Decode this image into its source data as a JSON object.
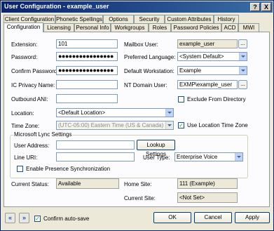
{
  "window": {
    "title": "User Configuration - example_user",
    "help": "?",
    "close": "X"
  },
  "tabs_top": [
    "Client Configuration",
    "Phonetic Spellings",
    "Options",
    "Security",
    "Custom Attributes",
    "History"
  ],
  "tabs_bottom": [
    "Configuration",
    "Licensing",
    "Personal Info",
    "Workgroups",
    "Roles",
    "Password Policies",
    "ACD",
    "MWI"
  ],
  "form": {
    "extension_label": "Extension:",
    "extension_value": "101",
    "password_label": "Password:",
    "password_value": "●●●●●●●●●●●●●●●●",
    "confirm_label": "Confirm Password:",
    "confirm_value": "●●●●●●●●●●●●●●●●",
    "ic_privacy_label": "IC Privacy Name:",
    "ic_privacy_value": "",
    "outbound_ani_label": "Outbound ANI:",
    "outbound_ani_value": "",
    "mailbox_label": "Mailbox User:",
    "mailbox_value": "example_user",
    "pref_lang_label": "Preferred Language:",
    "pref_lang_value": "<System Default>",
    "default_ws_label": "Default Workstation:",
    "default_ws_value": "Example",
    "nt_domain_label": "NT Domain User:",
    "nt_domain_value": "EXMP\\example_user",
    "exclude_label": "Exclude From Directory",
    "location_label": "Location:",
    "location_value": "<Default Location>",
    "timezone_label": "Time Zone:",
    "timezone_value": "(UTC-05:00) Eastern Time (US & Canada)",
    "use_loc_tz_label": "Use Location Time Zone",
    "ellipsis": "..."
  },
  "lync": {
    "title": "Microsoft Lync Settings",
    "user_address_label": "User Address:",
    "user_address_value": "",
    "lookup_label": "Lookup Settings",
    "line_uri_label": "Line URI:",
    "line_uri_value": "",
    "user_type_label": "User Type:",
    "user_type_value": "Enterprise Voice",
    "presence_label": "Enable Presence Synchronization"
  },
  "status": {
    "current_status_label": "Current Status:",
    "current_status_value": "Available",
    "home_site_label": "Home Site:",
    "home_site_value": "111 (Example)",
    "current_site_label": "Current Site:",
    "current_site_value": "<Not Set>"
  },
  "footer": {
    "confirm_autosave_label": "Confirm auto-save",
    "ok_label": "OK",
    "cancel_label": "Cancel",
    "apply_label": "Apply",
    "back": "«",
    "forward": "»"
  },
  "checkmark": "✓"
}
